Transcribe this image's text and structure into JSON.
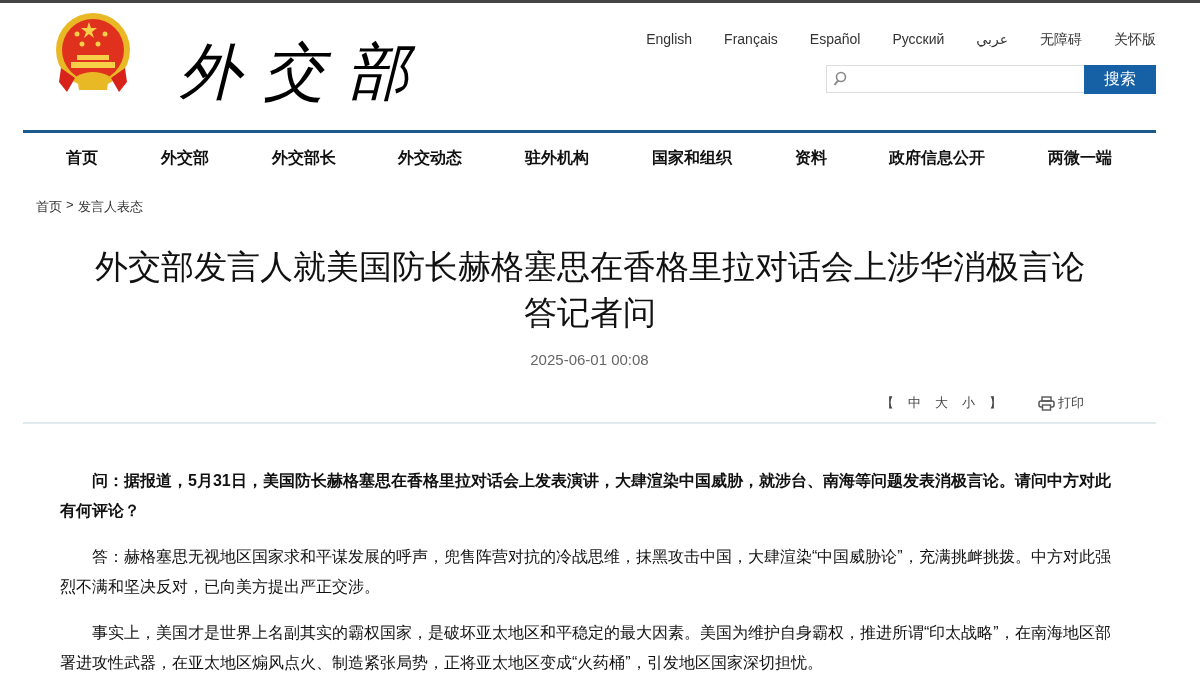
{
  "header": {
    "logo_text": "外交部",
    "languages": [
      "English",
      "Français",
      "Español",
      "Русский",
      "عربي",
      "无障碍",
      "关怀版"
    ],
    "search": {
      "button": "搜索"
    }
  },
  "nav": {
    "items": [
      "首页",
      "外交部",
      "外交部长",
      "外交动态",
      "驻外机构",
      "国家和组织",
      "资料",
      "政府信息公开",
      "两微一端"
    ]
  },
  "breadcrumb": {
    "items": [
      "首页",
      "发言人表态"
    ],
    "separator": ">"
  },
  "article": {
    "title_lines": [
      "外交部发言人就美国防长赫格塞思在香格里拉对话会上涉华消极言论",
      "答记者问"
    ],
    "date": "2025-06-01 00:08",
    "font_size": {
      "open": "【",
      "options": [
        "中",
        "大",
        "小"
      ],
      "close": "】"
    },
    "print": "打印",
    "paragraphs": [
      {
        "kind": "question",
        "text": "问：据报道，5月31日，美国防长赫格塞思在香格里拉对话会上发表演讲，大肆渲染中国威胁，就涉台、南海等问题发表消极言论。请问中方对此有何评论？"
      },
      {
        "kind": "answer",
        "text": "答：赫格塞思无视地区国家求和平谋发展的呼声，兜售阵营对抗的冷战思维，抹黑攻击中国，大肆渲染“中国威胁论”，充满挑衅挑拨。中方对此强烈不满和坚决反对，已向美方提出严正交涉。"
      },
      {
        "kind": "answer",
        "text": "事实上，美国才是世界上名副其实的霸权国家，是破坏亚太地区和平稳定的最大因素。美国为维护自身霸权，推进所谓“印太战略”，在南海地区部署进攻性武器，在亚太地区煽风点火、制造紧张局势，正将亚太地区变成“火药桶”，引发地区国家深切担忧。"
      }
    ]
  }
}
